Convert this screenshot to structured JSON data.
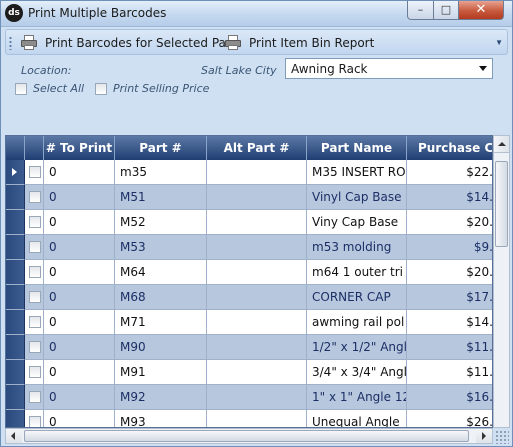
{
  "window": {
    "title": "Print Multiple Barcodes",
    "app_icon_text": "ds"
  },
  "toolbar": {
    "print_selected_label": "Print Barcodes for Selected Part",
    "print_bin_label": "Print Item Bin Report"
  },
  "options": {
    "location_label": "Location:",
    "city_label": "Salt Lake City",
    "bin_select_value": "Awning Rack",
    "select_all_label": "Select All",
    "print_selling_price_label": "Print Selling Price"
  },
  "grid": {
    "columns": [
      "# To Print",
      "Part #",
      "Alt Part #",
      "Part Name",
      "Purchase Cost"
    ],
    "rows": [
      {
        "to_print": "0",
        "part": "m35",
        "alt_part": "",
        "name": "M35 INSERT RO",
        "cost": "$22."
      },
      {
        "to_print": "0",
        "part": "M51",
        "alt_part": "",
        "name": "Vinyl Cap Base",
        "cost": "$14."
      },
      {
        "to_print": "0",
        "part": "M52",
        "alt_part": "",
        "name": "Viny Cap Base",
        "cost": "$20."
      },
      {
        "to_print": "0",
        "part": "M53",
        "alt_part": "",
        "name": "m53 molding",
        "cost": "$9."
      },
      {
        "to_print": "0",
        "part": "M64",
        "alt_part": "",
        "name": "m64  1 outer tri",
        "cost": "$20."
      },
      {
        "to_print": "0",
        "part": "M68",
        "alt_part": "",
        "name": "CORNER CAP",
        "cost": "$17."
      },
      {
        "to_print": "0",
        "part": "M71",
        "alt_part": "",
        "name": "awming rail pol",
        "cost": "$14."
      },
      {
        "to_print": "0",
        "part": "M90",
        "alt_part": "",
        "name": "1/2\" x 1/2\" Angl",
        "cost": "$11."
      },
      {
        "to_print": "0",
        "part": "M91",
        "alt_part": "",
        "name": "3/4\" x 3/4\" Angl",
        "cost": "$11."
      },
      {
        "to_print": "0",
        "part": "M92",
        "alt_part": "",
        "name": "1\" x 1\" Angle 12",
        "cost": "$16."
      },
      {
        "to_print": "0",
        "part": "M93",
        "alt_part": "",
        "name": "Unequal Angle",
        "cost": "$26."
      }
    ]
  },
  "colors": {
    "header_dark": "#203e72",
    "row_alt": "#b7c7dd",
    "panel_bg": "#cfe0f3"
  }
}
